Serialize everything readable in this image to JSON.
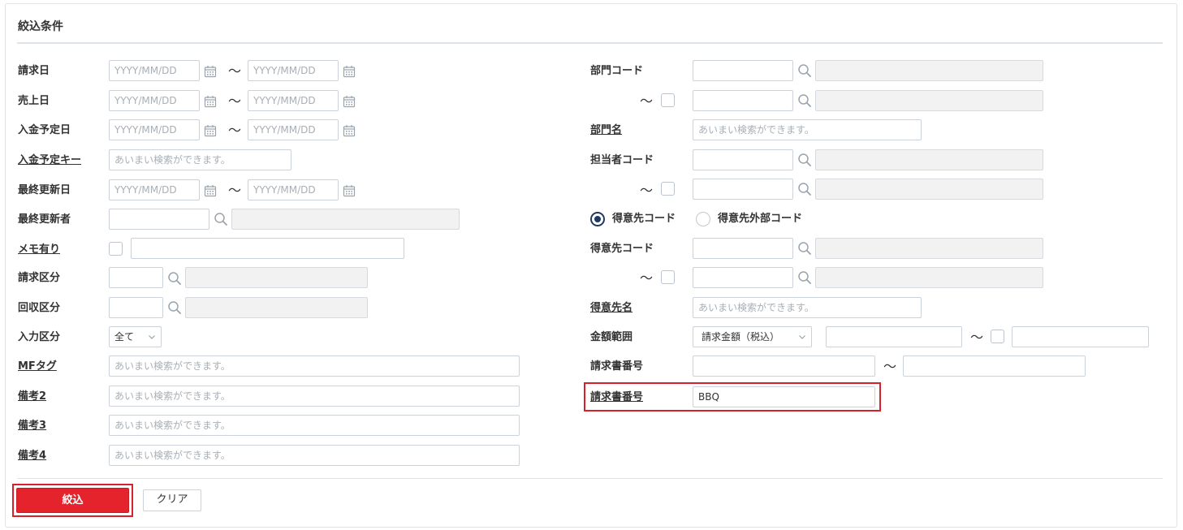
{
  "section": {
    "title": "絞込条件"
  },
  "placeholders": {
    "date": "YYYY/MM/DD",
    "fuzzy": "あいまい検索ができます。"
  },
  "tilde": "～",
  "left": {
    "seikyu_bi": "請求日",
    "uriage_bi": "売上日",
    "nyukin_yotei_bi": "入金予定日",
    "nyukin_yotei_key": "入金予定キー",
    "saishu_koshin_bi": "最終更新日",
    "saishu_koshin_sha": "最終更新者",
    "memo_ari": "メモ有り",
    "seikyu_kubun": "請求区分",
    "kaishu_kubun": "回収区分",
    "nyuryoku_kubun": "入力区分",
    "nyuryoku_kubun_value": "全て",
    "mf_tag": "MFタグ",
    "biko2": "備考2",
    "biko3": "備考3",
    "biko4": "備考4"
  },
  "right": {
    "bumon_code": "部門コード",
    "bumon_mei": "部門名",
    "tanto_code": "担当者コード",
    "radio_tokuisaki_code": "得意先コード",
    "radio_tokuisaki_gaibu": "得意先外部コード",
    "tokuisaki_code": "得意先コード",
    "tokuisaki_mei": "得意先名",
    "kingaku_hani": "金額範囲",
    "kingaku_select": "請求金額（税込）",
    "seikyusho_bango": "請求書番号",
    "seikyusho_bango2": "請求書番号",
    "seikyusho_bango2_value": "BBQ"
  },
  "buttons": {
    "filter": "絞込",
    "clear": "クリア"
  },
  "colors": {
    "accent": "#e5232d",
    "radio_selected": "#1d3a66",
    "highlight": "#d6202b"
  }
}
